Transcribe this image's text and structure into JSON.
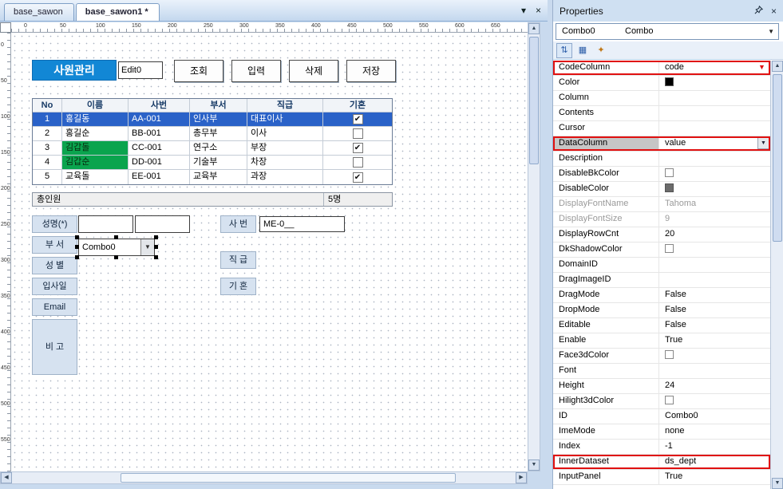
{
  "colors": {
    "accent_blue": "#1287d5",
    "selected_row_blue": "#2a62c8",
    "green_cell": "#0aa44e",
    "highlight_red": "#e01010",
    "label_bg": "#d6e2f0"
  },
  "tabs": [
    {
      "label": "base_sawon",
      "active": false
    },
    {
      "label": "base_sawon1 *",
      "active": true
    }
  ],
  "rulers": {
    "h_labels": [
      "0",
      "50",
      "100",
      "150",
      "200",
      "250",
      "300",
      "350",
      "400",
      "450",
      "500",
      "550",
      "600",
      "650"
    ],
    "v_labels": [
      "0",
      "50",
      "100",
      "150",
      "200",
      "250",
      "300",
      "350",
      "400",
      "450",
      "500",
      "550"
    ]
  },
  "canvas": {
    "title_button": "사원관리",
    "edit0": "Edit0",
    "action_buttons": [
      "조회",
      "입력",
      "삭제",
      "저장"
    ],
    "grid": {
      "headers": [
        "No",
        "이름",
        "사번",
        "부서",
        "직급",
        "기혼"
      ],
      "rows": [
        {
          "no": "1",
          "name": "홍길동",
          "id": "AA-001",
          "dept": "인사부",
          "position": "대표이사",
          "married": true,
          "selected": true,
          "name_green": false
        },
        {
          "no": "2",
          "name": "홍길순",
          "id": "BB-001",
          "dept": "총무부",
          "position": "이사",
          "married": false,
          "selected": false,
          "name_green": false
        },
        {
          "no": "3",
          "name": "김갑돌",
          "id": "CC-001",
          "dept": "연구소",
          "position": "부장",
          "married": true,
          "selected": false,
          "name_green": true
        },
        {
          "no": "4",
          "name": "김갑순",
          "id": "DD-001",
          "dept": "기술부",
          "position": "차장",
          "married": false,
          "selected": false,
          "name_green": true
        },
        {
          "no": "5",
          "name": "교육돌",
          "id": "EE-001",
          "dept": "교육부",
          "position": "과장",
          "married": true,
          "selected": false,
          "name_green": false
        }
      ],
      "summary_label": "총인원",
      "summary_value": "5명"
    },
    "form": {
      "left_labels": [
        "성명(*)",
        "부 서",
        "성 별",
        "입사일",
        "Email",
        "비 고"
      ],
      "combo_value": "Combo0",
      "right_labels": [
        "사 번",
        "직 급",
        "기 혼"
      ],
      "sabun_value": "ME-0__"
    }
  },
  "properties": {
    "title": "Properties",
    "selector": {
      "id": "Combo0",
      "type": "Combo"
    },
    "toolbar_icons": [
      "sort",
      "categorized",
      "property-pages"
    ],
    "rows": [
      {
        "name": "CodeColumn",
        "value": "code",
        "highlight": true,
        "dropdown": true,
        "red_arrow": true
      },
      {
        "name": "Color",
        "value": "",
        "swatch": "#000000"
      },
      {
        "name": "Column",
        "value": ""
      },
      {
        "name": "Contents",
        "value": ""
      },
      {
        "name": "Cursor",
        "value": ""
      },
      {
        "name": "DataColumn",
        "value": "value",
        "highlight": true,
        "dropdown": true,
        "name_selected": true
      },
      {
        "name": "Description",
        "value": ""
      },
      {
        "name": "DisableBkColor",
        "value": "",
        "checkbox": true
      },
      {
        "name": "DisableColor",
        "value": "",
        "swatch": "#6b6b6b"
      },
      {
        "name": "DisplayFontName",
        "value": "Tahoma",
        "dim": true
      },
      {
        "name": "DisplayFontSize",
        "value": "9",
        "dim": true
      },
      {
        "name": "DisplayRowCnt",
        "value": "20"
      },
      {
        "name": "DkShadowColor",
        "value": "",
        "checkbox": true
      },
      {
        "name": "DomainID",
        "value": ""
      },
      {
        "name": "DragImageID",
        "value": ""
      },
      {
        "name": "DragMode",
        "value": "False"
      },
      {
        "name": "DropMode",
        "value": "False"
      },
      {
        "name": "Editable",
        "value": "False"
      },
      {
        "name": "Enable",
        "value": "True"
      },
      {
        "name": "Face3dColor",
        "value": "",
        "checkbox": true
      },
      {
        "name": "Font",
        "value": ""
      },
      {
        "name": "Height",
        "value": "24"
      },
      {
        "name": "Hilight3dColor",
        "value": "",
        "checkbox": true
      },
      {
        "name": "ID",
        "value": "Combo0"
      },
      {
        "name": "ImeMode",
        "value": "none"
      },
      {
        "name": "Index",
        "value": "-1"
      },
      {
        "name": "InnerDataset",
        "value": "ds_dept",
        "highlight": true
      },
      {
        "name": "InputPanel",
        "value": "True"
      }
    ]
  }
}
